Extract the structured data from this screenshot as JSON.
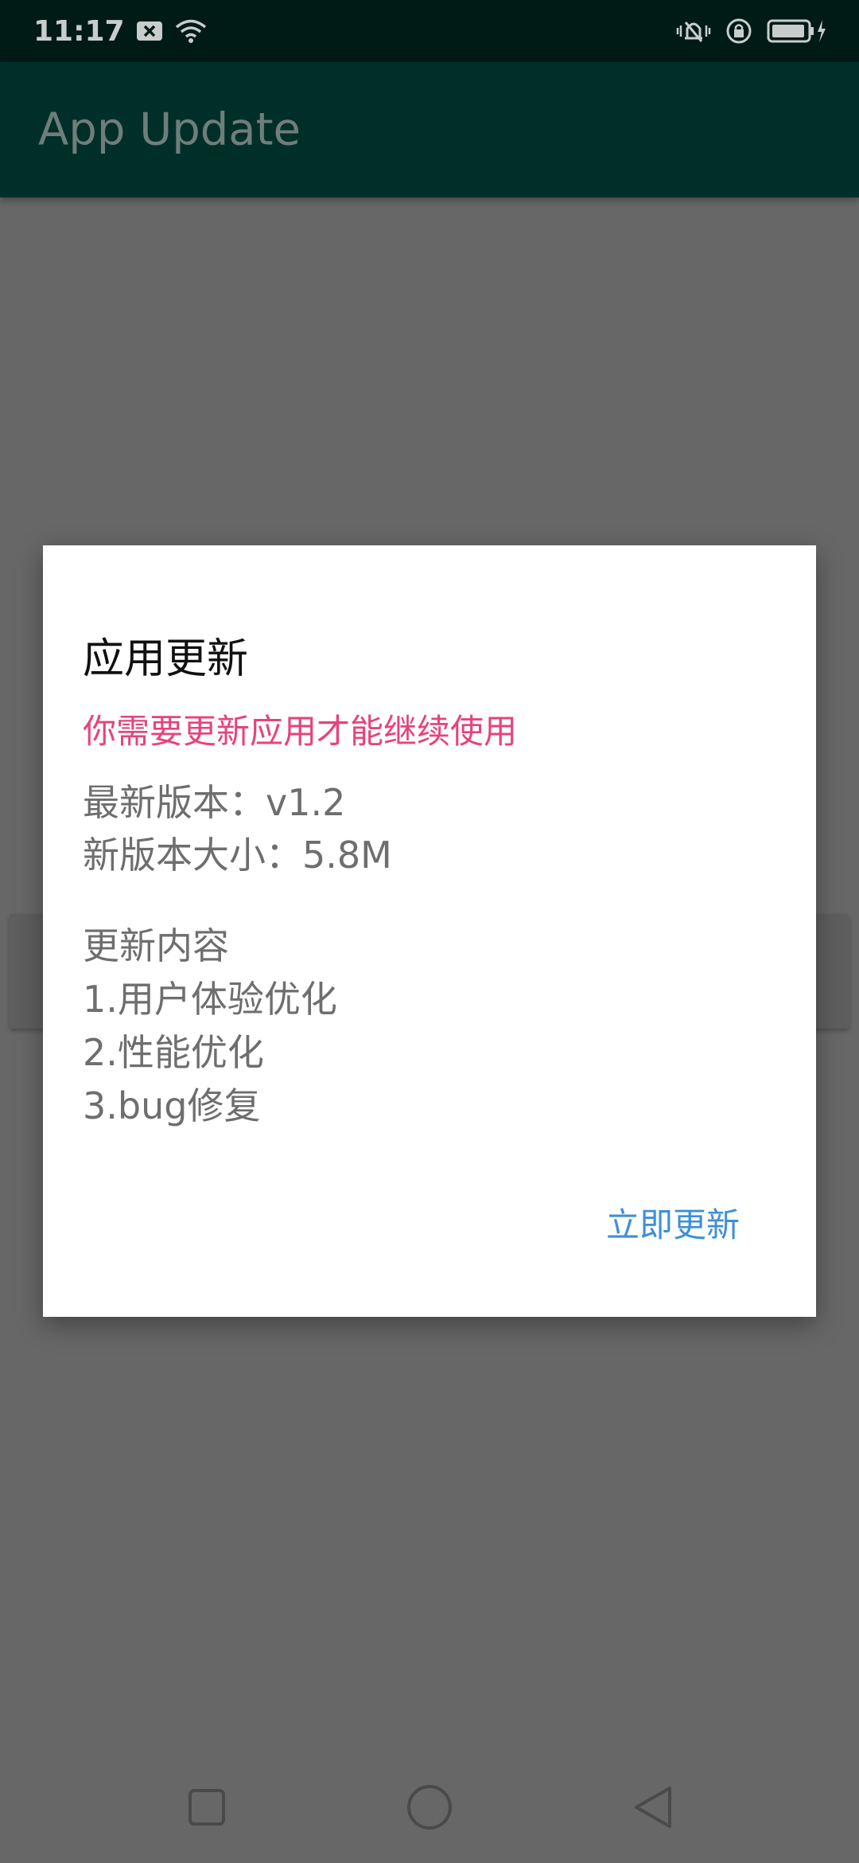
{
  "status_bar": {
    "time": "11:17"
  },
  "app_bar": {
    "title": "App Update"
  },
  "dialog": {
    "title": "应用更新",
    "warning": "你需要更新应用才能继续使用",
    "latest_version": "最新版本：v1.2",
    "new_version_size": "新版本大小：5.8M",
    "notes_heading": "更新内容",
    "notes": [
      "1.用户体验优化",
      "2.性能优化",
      "3.bug修复"
    ],
    "update_button_label": "立即更新"
  },
  "colors": {
    "status_bar_bg": "#001a16",
    "app_bar_bg": "#002f2a",
    "scrim": "#676767",
    "warning_text": "#e8427c",
    "button_text": "#3f8fd9"
  }
}
